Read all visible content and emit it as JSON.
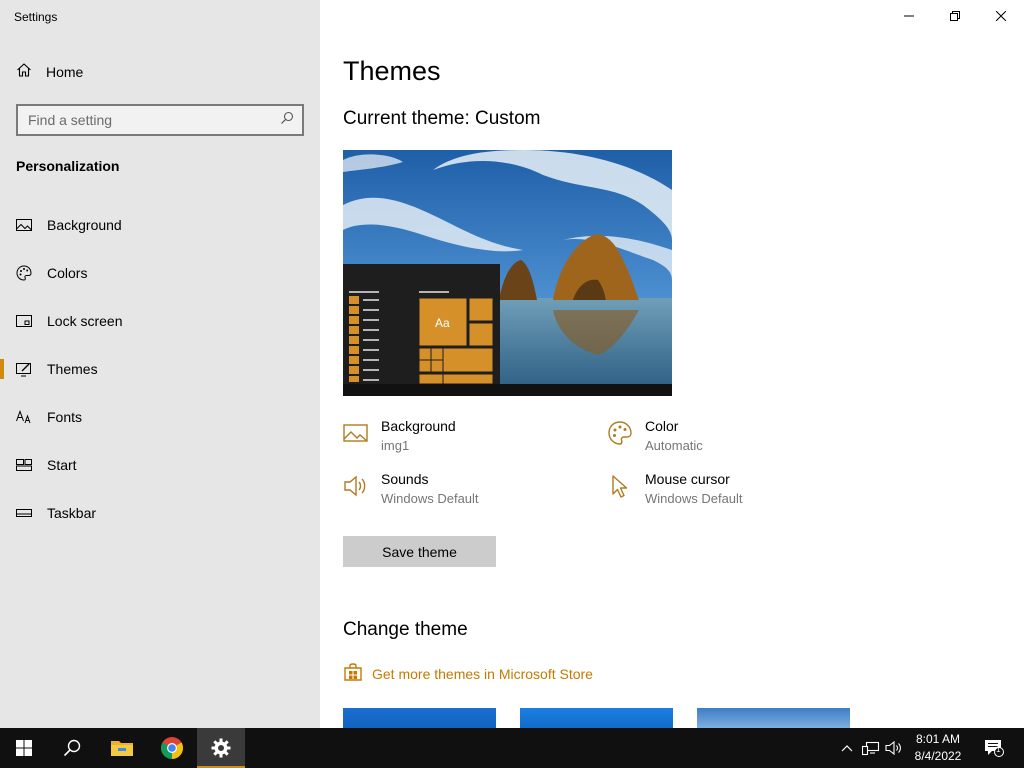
{
  "window": {
    "title": "Settings"
  },
  "sidebar": {
    "home_label": "Home",
    "search_placeholder": "Find a setting",
    "section_title": "Personalization",
    "items": [
      {
        "label": "Background",
        "icon": "picture-icon"
      },
      {
        "label": "Colors",
        "icon": "palette-icon"
      },
      {
        "label": "Lock screen",
        "icon": "lock-screen-icon"
      },
      {
        "label": "Themes",
        "icon": "themes-icon",
        "active": true
      },
      {
        "label": "Fonts",
        "icon": "fonts-icon"
      },
      {
        "label": "Start",
        "icon": "start-icon"
      },
      {
        "label": "Taskbar",
        "icon": "taskbar-icon"
      }
    ]
  },
  "main": {
    "title": "Themes",
    "current_theme": "Current theme: Custom",
    "properties": {
      "background": {
        "label": "Background",
        "value": "img1"
      },
      "color": {
        "label": "Color",
        "value": "Automatic"
      },
      "sounds": {
        "label": "Sounds",
        "value": "Windows Default"
      },
      "cursor": {
        "label": "Mouse cursor",
        "value": "Windows Default"
      }
    },
    "save_button": "Save theme",
    "change_theme": "Change theme",
    "store_link": "Get more themes in Microsoft Store",
    "preview_tile_label": "Aa"
  },
  "taskbar": {
    "time": "8:01 AM",
    "date": "8/4/2022",
    "notification_count": "1",
    "apps": [
      "start-icon",
      "search-icon",
      "file-explorer-icon",
      "chrome-icon",
      "settings-icon"
    ]
  },
  "colors": {
    "accent": "#d08a10",
    "sidebar_bg": "#e6e6e6",
    "taskbar_bg": "#101010",
    "link": "#c47a00",
    "secondary_text": "#767676"
  }
}
